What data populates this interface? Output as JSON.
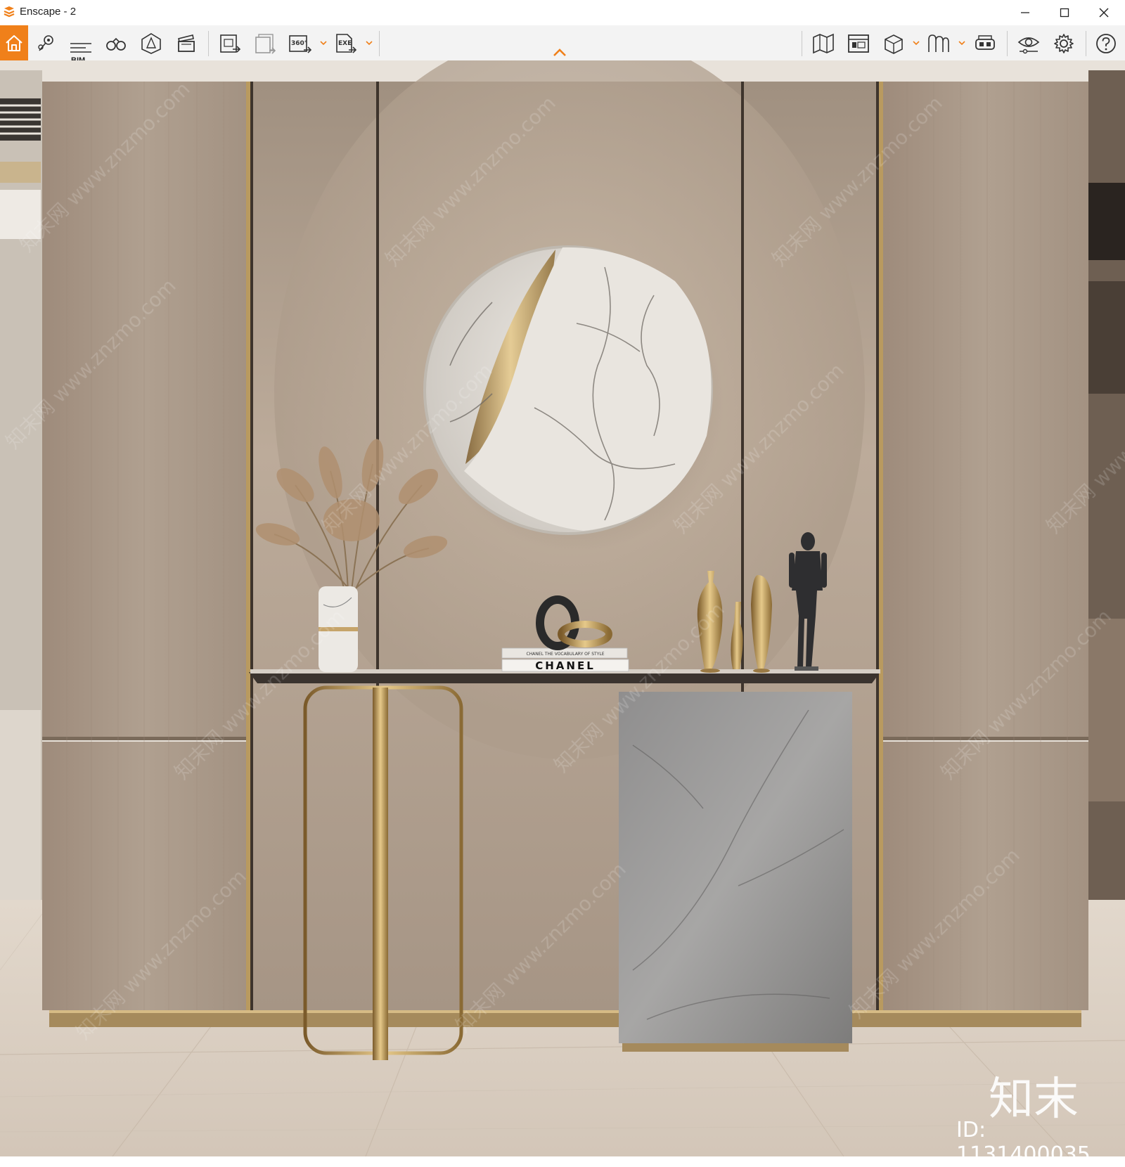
{
  "window": {
    "title": "Enscape - 2",
    "controls": [
      "minimize",
      "maximize",
      "close"
    ]
  },
  "toolbar": {
    "bim_label": "BIM",
    "pano_label": "360°",
    "exe_label": "EXE",
    "accent_color": "#f0801a",
    "left_tools": [
      "home-icon",
      "location-pin-icon",
      "bim-info-icon",
      "binoculars-icon",
      "safe-frame-icon",
      "clapperboard-icon",
      "screenshot-export-icon",
      "batch-render-icon",
      "panorama-export-icon",
      "exe-export-icon"
    ],
    "right_tools": [
      "map-icon",
      "asset-library-icon",
      "cube-view-icon",
      "material-editor-icon",
      "vr-headset-icon",
      "visual-settings-icon",
      "settings-gear-icon",
      "help-icon"
    ]
  },
  "scene": {
    "book_title": "CHANEL",
    "book_subtitle": "CHANEL THE VOCABULARY OF STYLE",
    "watermark": "知末网 www.znzmo.com",
    "brand": "知末",
    "id_label": "ID: 1131400035"
  }
}
